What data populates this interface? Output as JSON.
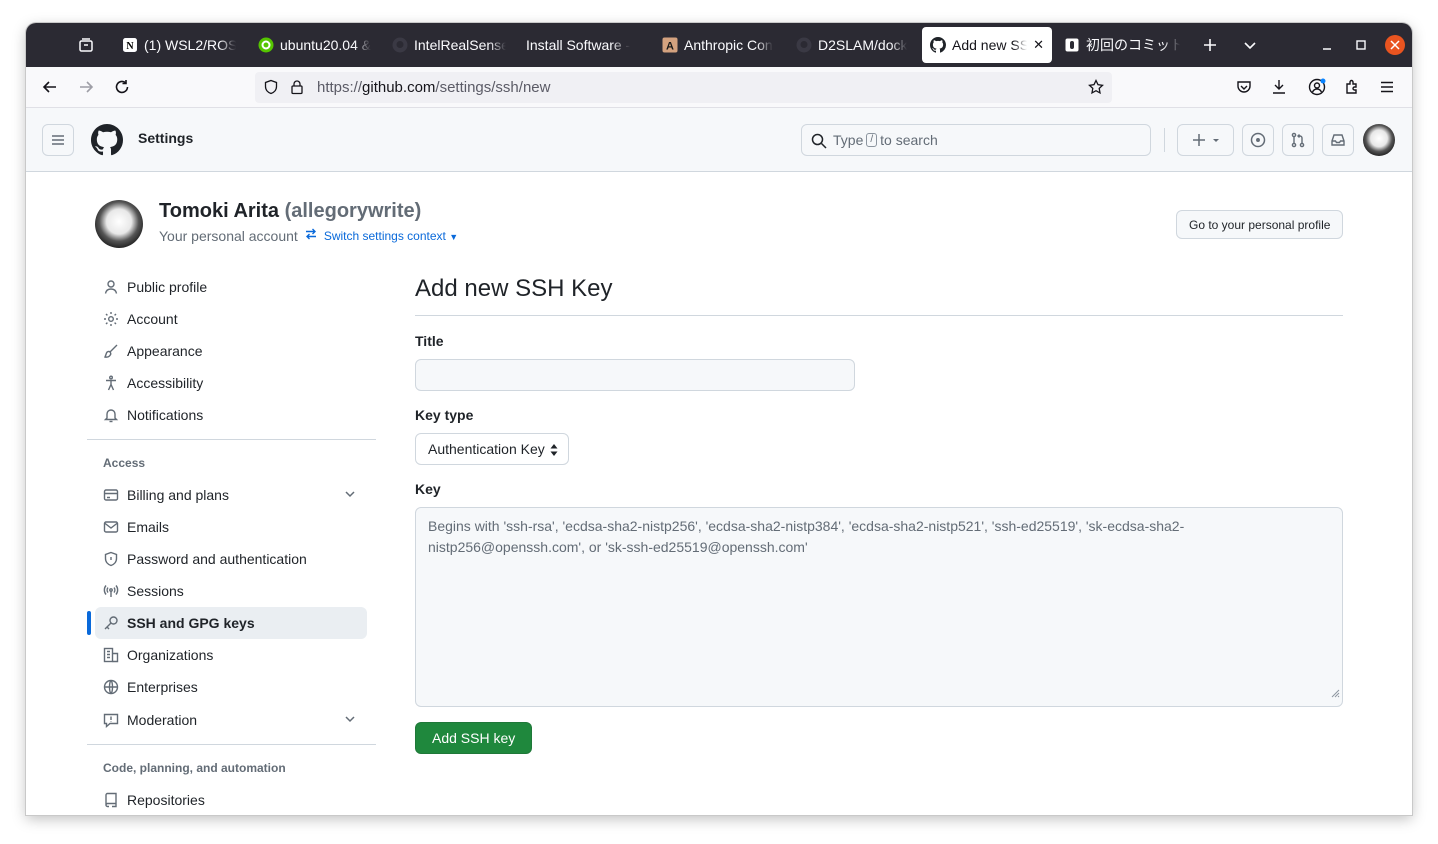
{
  "browser": {
    "tabs": [
      {
        "label": "(1) WSL2/ROS",
        "favicon": "notion-icon"
      },
      {
        "label": "ubuntu20.04 & ",
        "favicon": "qiita-icon"
      },
      {
        "label": "IntelRealSense",
        "favicon": "github-icon"
      },
      {
        "label": "Install Software - ",
        "favicon": "none"
      },
      {
        "label": "Anthropic Con",
        "favicon": "anthropic-icon"
      },
      {
        "label": "D2SLAM/dock",
        "favicon": "github-icon"
      },
      {
        "label": "Add new SS",
        "favicon": "github-icon",
        "active": true
      },
      {
        "label": "初回のコミット",
        "favicon": "page-icon"
      }
    ],
    "url_prefix": "https://",
    "url_host": "github.com",
    "url_path": "/settings/ssh/new"
  },
  "header": {
    "title": "Settings",
    "search_pre": "Type",
    "search_key": "/",
    "search_post": "to search"
  },
  "profile": {
    "name": "Tomoki Arita",
    "handle": "(allegorywrite)",
    "account_label": "Your personal account",
    "switch_label": "Switch settings context",
    "go_profile": "Go to your personal profile"
  },
  "sidebar": {
    "items_top": [
      {
        "label": "Public profile",
        "icon": "person-icon"
      },
      {
        "label": "Account",
        "icon": "gear-icon"
      },
      {
        "label": "Appearance",
        "icon": "paintbrush-icon"
      },
      {
        "label": "Accessibility",
        "icon": "accessibility-icon"
      },
      {
        "label": "Notifications",
        "icon": "bell-icon"
      }
    ],
    "access_heading": "Access",
    "items_access": [
      {
        "label": "Billing and plans",
        "icon": "credit-card-icon"
      },
      {
        "label": "Emails",
        "icon": "mail-icon"
      },
      {
        "label": "Password and authentication",
        "icon": "shield-icon"
      },
      {
        "label": "Sessions",
        "icon": "broadcast-icon"
      },
      {
        "label": "SSH and GPG keys",
        "icon": "key-icon"
      },
      {
        "label": "Organizations",
        "icon": "organization-icon"
      },
      {
        "label": "Enterprises",
        "icon": "globe-icon"
      },
      {
        "label": "Moderation",
        "icon": "report-icon"
      }
    ],
    "code_heading": "Code, planning, and automation",
    "items_code": [
      {
        "label": "Repositories",
        "icon": "repo-icon"
      }
    ]
  },
  "main": {
    "heading": "Add new SSH Key",
    "title_label": "Title",
    "title_value": "",
    "key_type_label": "Key type",
    "key_type_value": "Authentication Key",
    "key_label": "Key",
    "key_placeholder": "Begins with 'ssh-rsa', 'ecdsa-sha2-nistp256', 'ecdsa-sha2-nistp384', 'ecdsa-sha2-nistp521', 'ssh-ed25519', 'sk-ecdsa-sha2-nistp256@openssh.com', or 'sk-ssh-ed25519@openssh.com'",
    "submit_label": "Add SSH key"
  },
  "colors": {
    "accent": "#0969da",
    "primary_button": "#1f883d",
    "close_button": "#e95420"
  }
}
